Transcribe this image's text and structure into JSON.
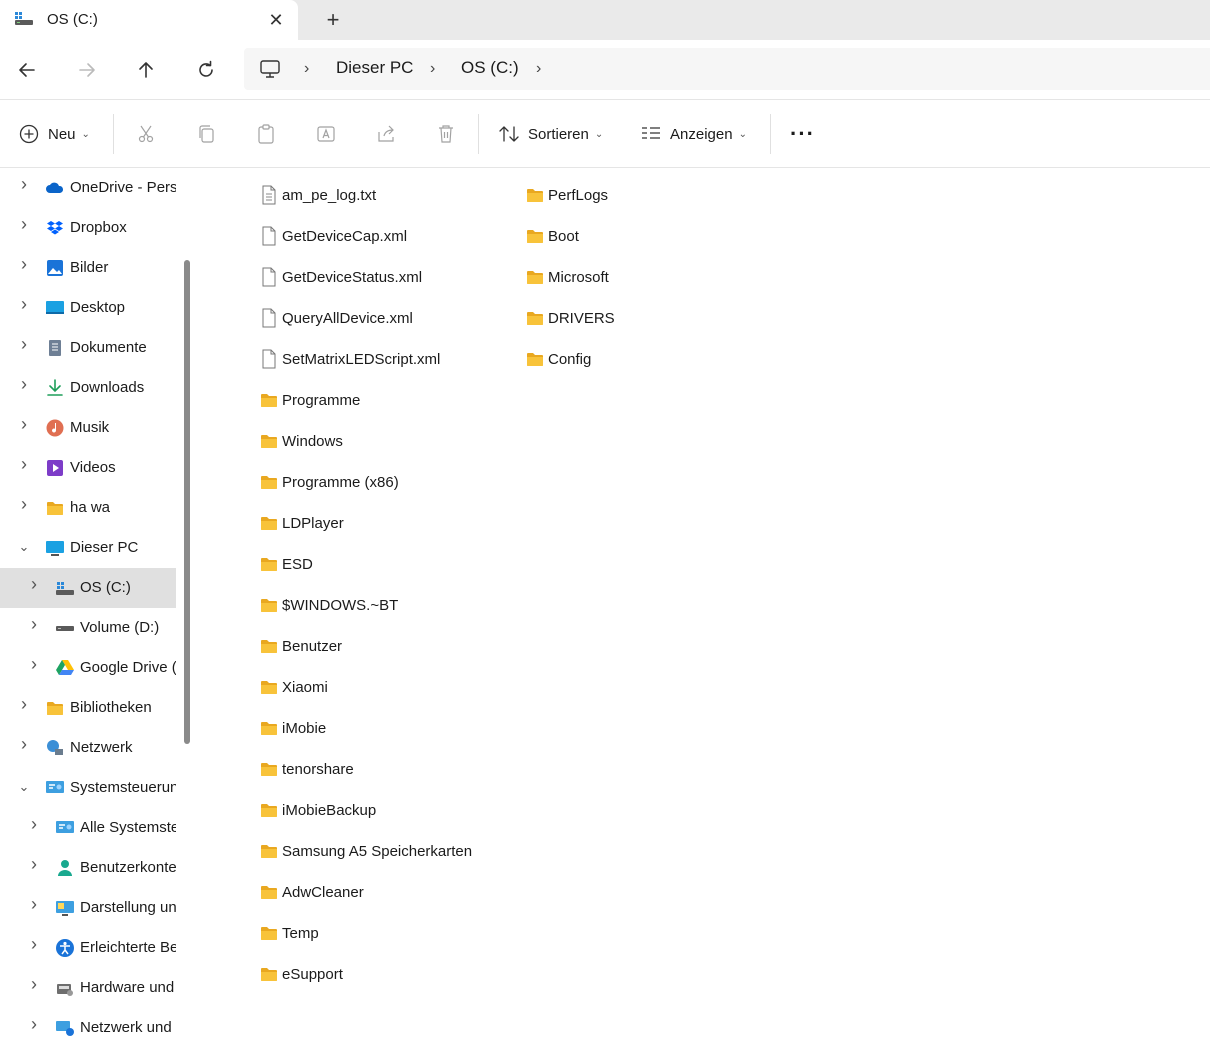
{
  "tab": {
    "title": "OS (C:)",
    "close": "✕",
    "new_tab": "+"
  },
  "address": {
    "crumbs": [
      "Dieser PC",
      "OS (C:)"
    ],
    "separator": "›"
  },
  "commands": {
    "new_label": "Neu",
    "sort_label": "Sortieren",
    "view_label": "Anzeigen",
    "more": "···"
  },
  "sidebar": {
    "items": [
      {
        "label": "OneDrive - Persönlich",
        "icon": "onedrive-icon",
        "expanded": false,
        "level": 0
      },
      {
        "label": "Dropbox",
        "icon": "dropbox-icon",
        "expanded": false,
        "level": 0
      },
      {
        "label": "Bilder",
        "icon": "pictures-icon",
        "expanded": false,
        "level": 0
      },
      {
        "label": "Desktop",
        "icon": "desktop-icon",
        "expanded": false,
        "level": 0
      },
      {
        "label": "Dokumente",
        "icon": "documents-icon",
        "expanded": false,
        "level": 0
      },
      {
        "label": "Downloads",
        "icon": "downloads-icon",
        "expanded": false,
        "level": 0
      },
      {
        "label": "Musik",
        "icon": "music-icon",
        "expanded": false,
        "level": 0
      },
      {
        "label": "Videos",
        "icon": "videos-icon",
        "expanded": false,
        "level": 0
      },
      {
        "label": "ha wa",
        "icon": "folder-icon",
        "expanded": false,
        "level": 0
      },
      {
        "label": "Dieser PC",
        "icon": "this-pc-icon",
        "expanded": true,
        "level": 0
      },
      {
        "label": "OS (C:)",
        "icon": "drive-c-icon",
        "expanded": false,
        "level": 1,
        "selected": true
      },
      {
        "label": "Volume (D:)",
        "icon": "drive-icon",
        "expanded": false,
        "level": 1
      },
      {
        "label": "Google Drive (",
        "icon": "google-drive-icon",
        "expanded": false,
        "level": 1
      },
      {
        "label": "Bibliotheken",
        "icon": "libraries-icon",
        "expanded": false,
        "level": 0
      },
      {
        "label": "Netzwerk",
        "icon": "network-icon",
        "expanded": false,
        "level": 0
      },
      {
        "label": "Systemsteuerung",
        "icon": "control-panel-icon",
        "expanded": true,
        "level": 0
      },
      {
        "label": "Alle Systemsteuerungselemente",
        "icon": "control-panel-icon",
        "expanded": false,
        "level": 1
      },
      {
        "label": "Benutzerkonten",
        "icon": "user-accounts-icon",
        "expanded": false,
        "level": 1
      },
      {
        "label": "Darstellung und Anpassung",
        "icon": "appearance-icon",
        "expanded": false,
        "level": 1
      },
      {
        "label": "Erleichterte Bedienung",
        "icon": "accessibility-icon",
        "expanded": false,
        "level": 1
      },
      {
        "label": "Hardware und Sound",
        "icon": "hardware-icon",
        "expanded": false,
        "level": 1
      },
      {
        "label": "Netzwerk und Internet",
        "icon": "network-internet-icon",
        "expanded": false,
        "level": 1
      }
    ]
  },
  "files": {
    "column1": [
      {
        "name": "am_pe_log.txt",
        "type": "text"
      },
      {
        "name": "GetDeviceCap.xml",
        "type": "file"
      },
      {
        "name": "GetDeviceStatus.xml",
        "type": "file"
      },
      {
        "name": "QueryAllDevice.xml",
        "type": "file"
      },
      {
        "name": "SetMatrixLEDScript.xml",
        "type": "file"
      },
      {
        "name": "Programme",
        "type": "folder"
      },
      {
        "name": "Windows",
        "type": "folder"
      },
      {
        "name": "Programme (x86)",
        "type": "folder"
      },
      {
        "name": "LDPlayer",
        "type": "folder"
      },
      {
        "name": "ESD",
        "type": "folder"
      },
      {
        "name": "$WINDOWS.~BT",
        "type": "folder"
      },
      {
        "name": "Benutzer",
        "type": "folder"
      },
      {
        "name": "Xiaomi",
        "type": "folder"
      },
      {
        "name": "iMobie",
        "type": "folder"
      },
      {
        "name": "tenorshare",
        "type": "folder"
      },
      {
        "name": "iMobieBackup",
        "type": "folder"
      },
      {
        "name": "Samsung A5 Speicherkarten",
        "type": "folder"
      },
      {
        "name": "AdwCleaner",
        "type": "folder"
      },
      {
        "name": "Temp",
        "type": "folder"
      },
      {
        "name": "eSupport",
        "type": "folder"
      }
    ],
    "column2": [
      {
        "name": "PerfLogs",
        "type": "folder"
      },
      {
        "name": "Boot",
        "type": "folder"
      },
      {
        "name": "Microsoft",
        "type": "folder"
      },
      {
        "name": "DRIVERS",
        "type": "folder"
      },
      {
        "name": "Config",
        "type": "folder"
      }
    ]
  },
  "colors": {
    "folder": "#F8C33A",
    "folder_dark": "#E9A820",
    "accent": "#0067C0",
    "selection": "#E0E0E0"
  }
}
